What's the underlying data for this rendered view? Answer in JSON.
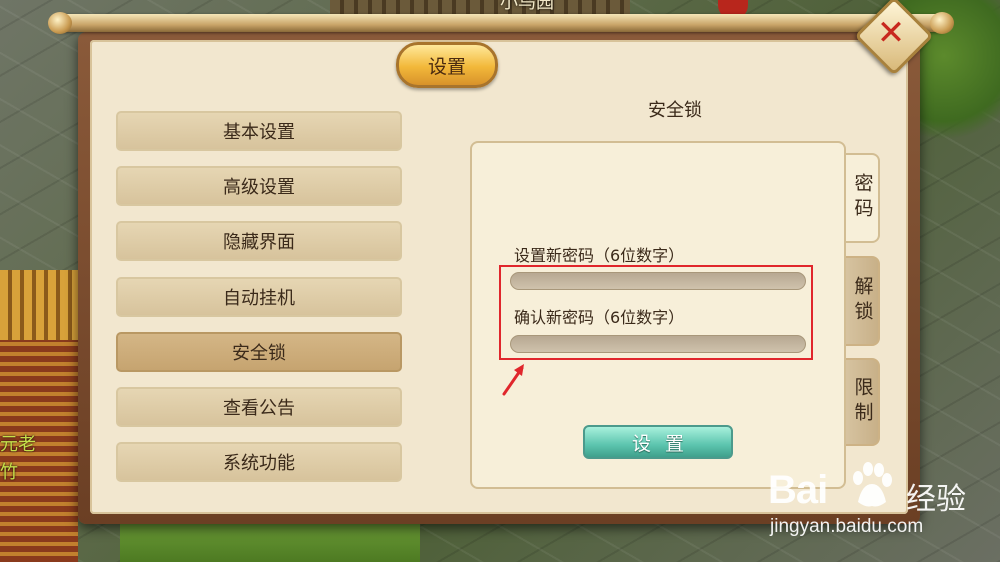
{
  "world": {
    "map_name": "小鸟园",
    "npc_line1": "元老",
    "npc_line2": "竹"
  },
  "dialog": {
    "title": "设置",
    "close_icon": "close-x-icon"
  },
  "menu": {
    "items": [
      {
        "label": "基本设置",
        "active": false
      },
      {
        "label": "高级设置",
        "active": false
      },
      {
        "label": "隐藏界面",
        "active": false
      },
      {
        "label": "自动挂机",
        "active": false
      },
      {
        "label": "安全锁",
        "active": true
      },
      {
        "label": "查看公告",
        "active": false
      },
      {
        "label": "系统功能",
        "active": false
      }
    ]
  },
  "panel": {
    "title": "安全锁",
    "tabs": [
      {
        "label": "密码",
        "active": true
      },
      {
        "label": "解锁",
        "active": false
      },
      {
        "label": "限制",
        "active": false
      }
    ],
    "new_password_label": "设置新密码（6位数字）",
    "new_password_value": "",
    "confirm_password_label": "确认新密码（6位数字）",
    "confirm_password_value": "",
    "submit_label": "设置"
  },
  "watermark": {
    "logo": "Bai",
    "logo_suffix": "经验",
    "url": "jingyan.baidu.com"
  },
  "colors": {
    "highlight": "#e0262c",
    "accent_button": "#5cc4ae",
    "title_plaque": "#f2b83a"
  }
}
